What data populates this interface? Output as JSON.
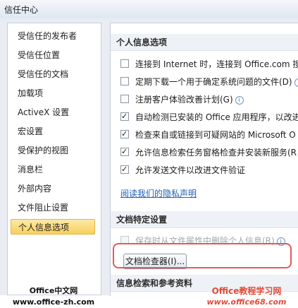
{
  "window": {
    "title": "信任中心"
  },
  "sidebar": {
    "items": [
      {
        "label": "受信任的发布者"
      },
      {
        "label": "受信任位置"
      },
      {
        "label": "受信任的文档"
      },
      {
        "label": "加载项"
      },
      {
        "label": "ActiveX 设置"
      },
      {
        "label": "宏设置"
      },
      {
        "label": "受保护的视图"
      },
      {
        "label": "消息栏"
      },
      {
        "label": "外部内容"
      },
      {
        "label": "文件阻止设置"
      },
      {
        "label": "个人信息选项",
        "selected": true
      }
    ]
  },
  "personal": {
    "heading": "个人信息选项",
    "options": [
      {
        "label": "连接到 Internet 时，连接到 Office.com 搜",
        "checked": false
      },
      {
        "label": "定期下载一个用于确定系统问题的文件(D)",
        "checked": false,
        "info": true
      },
      {
        "label": "注册客户体验改善计划(G)",
        "checked": false,
        "info": true
      },
      {
        "label": "自动检测已安装的 Office 应用程序，以改进",
        "checked": true
      },
      {
        "label": "检查来自或链接到可疑网站的 Microsoft O",
        "checked": true
      },
      {
        "label": "允许信息检索任务窗格检查并安装新服务(R",
        "checked": true
      },
      {
        "label": "允许发送文件以改进文件验证",
        "checked": true
      }
    ],
    "privacy_link": "阅读我们的隐私声明"
  },
  "document": {
    "heading": "文档特定设置",
    "remove_personal": {
      "label": "保存时从文件属性中删除个人信息(R)",
      "checked": false,
      "disabled": true
    },
    "inspector_button": "文档检查器(I)..."
  },
  "research": {
    "heading": "信息检索和参考资料"
  },
  "watermark": {
    "left_line1": "Office中文网",
    "left_line2": "www.office-zh.com",
    "right_line1": "Office教程学习网",
    "right_line2": "www.office68.com"
  },
  "info_icon_glyph": "i",
  "colors": {
    "selected_bg": "#f8cf5c",
    "link": "#1d5fb8",
    "highlight": "#e35a5a"
  }
}
